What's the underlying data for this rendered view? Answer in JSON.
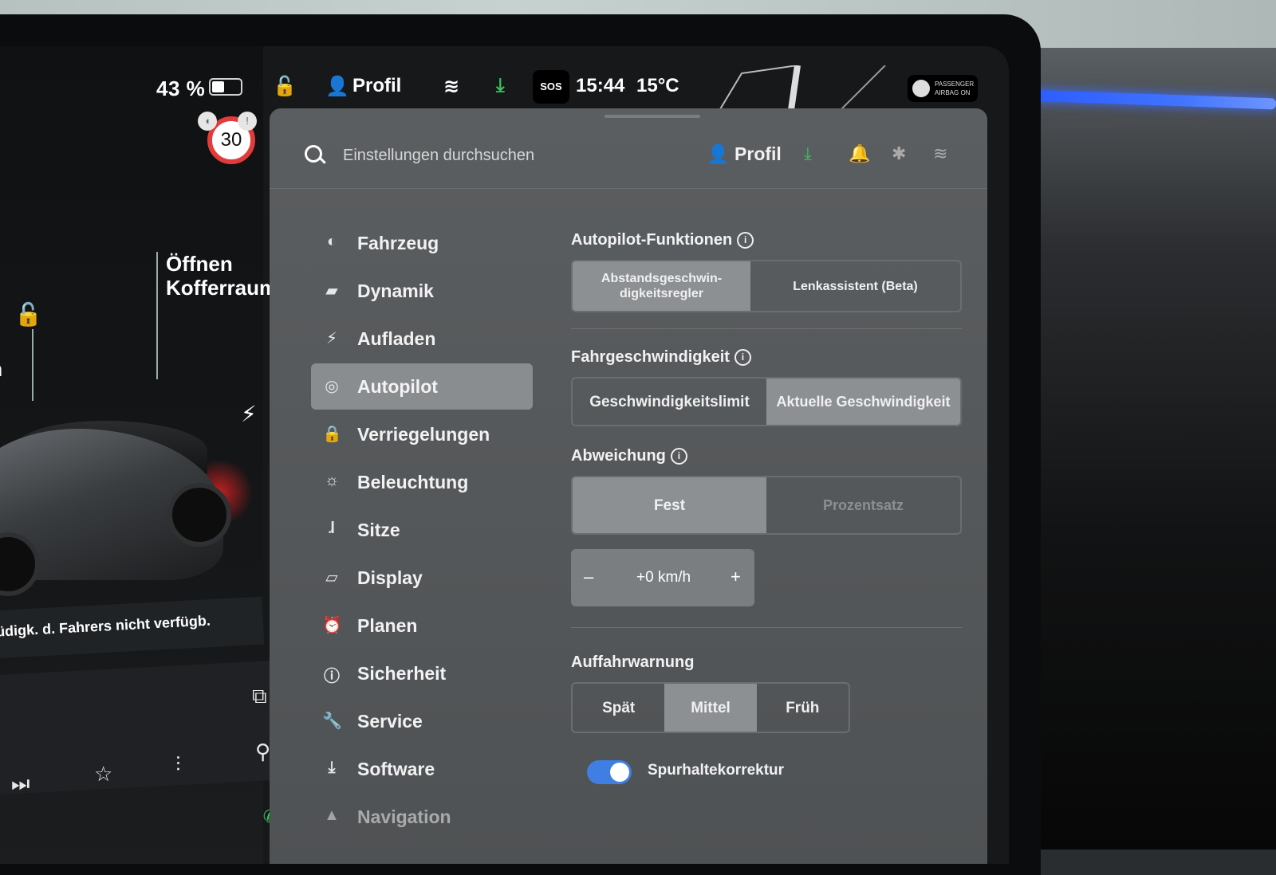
{
  "car": {
    "battery_percent": "43 %",
    "battery_level": 0.43,
    "speed_limit": "30",
    "trunk_label_line1": "Öffnen",
    "trunk_label_line2": "Kofferraum",
    "frunk_label_cut": "m",
    "alert_text": "Müdigk. d. Fahrers nicht verfügb."
  },
  "statusbar": {
    "profile": "Profil",
    "sos": "SOS",
    "time": "15:44",
    "temperature": "15°C",
    "airbag_label": "PASSENGER AIRBAG ON"
  },
  "settings": {
    "search_placeholder": "Einstellungen durchsuchen",
    "header_profile": "Profil",
    "nav": [
      {
        "label": "Fahrzeug",
        "icon": "toggle-icon"
      },
      {
        "label": "Dynamik",
        "icon": "car-icon"
      },
      {
        "label": "Aufladen",
        "icon": "bolt-icon"
      },
      {
        "label": "Autopilot",
        "icon": "steering-wheel-icon",
        "active": true
      },
      {
        "label": "Verriegelungen",
        "icon": "lock-icon"
      },
      {
        "label": "Beleuchtung",
        "icon": "sun-icon"
      },
      {
        "label": "Sitze",
        "icon": "seat-icon"
      },
      {
        "label": "Display",
        "icon": "display-icon"
      },
      {
        "label": "Planen",
        "icon": "alarm-icon"
      },
      {
        "label": "Sicherheit",
        "icon": "alert-circle-icon"
      },
      {
        "label": "Service",
        "icon": "wrench-icon"
      },
      {
        "label": "Software",
        "icon": "download-icon"
      },
      {
        "label": "Navigation",
        "icon": "navigation-icon"
      }
    ],
    "autopilot_features": {
      "title": "Autopilot-Funktionen",
      "options": [
        "Abstandsgeschwin-digkeitsregler",
        "Lenkassistent (Beta)"
      ],
      "selected": 0
    },
    "driving_speed": {
      "title": "Fahrgeschwindigkeit",
      "options": [
        "Geschwindigkeitslimit",
        "Aktuelle Geschwindigkeit"
      ],
      "selected": 1
    },
    "offset": {
      "title": "Abweichung",
      "options": [
        "Fest",
        "Prozentsatz"
      ],
      "selected": 0,
      "value": "+0 km/h",
      "minus": "–",
      "plus": "+"
    },
    "collision_warning": {
      "title": "Auffahrwarnung",
      "options": [
        "Spät",
        "Mittel",
        "Früh"
      ],
      "selected": 1
    },
    "lane_correction": {
      "label": "Spurhaltekorrektur",
      "enabled": true
    }
  },
  "colors": {
    "accent_green": "#35c65a",
    "toggle_blue": "#3f7fe3",
    "speed_red": "#e23b3b"
  }
}
